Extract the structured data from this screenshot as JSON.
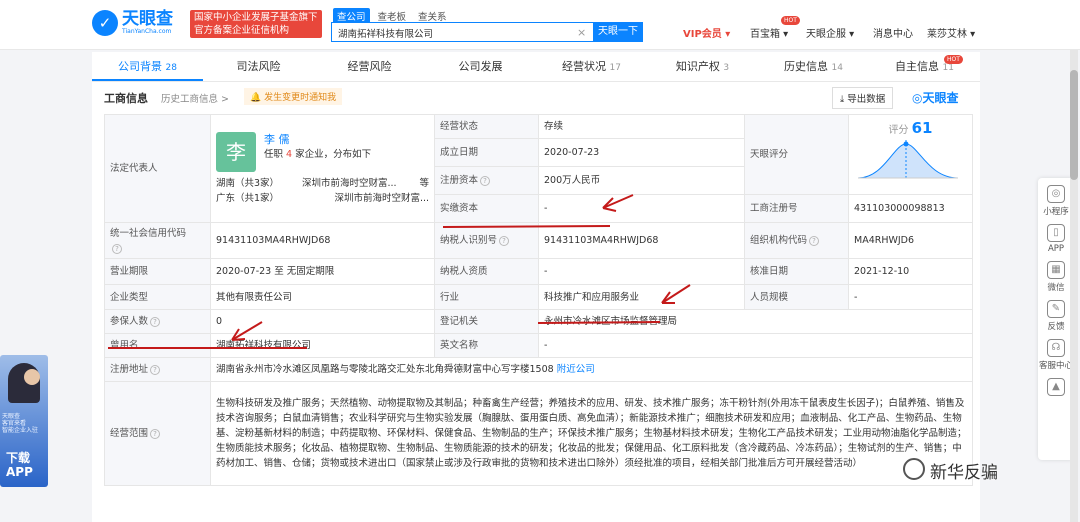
{
  "header": {
    "logo_cn": "天眼查",
    "logo_en": "TianYanCha.com",
    "slogan_1": "国家中小企业发展子基金旗下",
    "slogan_2": "官方备案企业征信机构",
    "search_tabs": [
      "查公司",
      "查老板",
      "查关系"
    ],
    "search_value": "湖南拓祥科技有限公司",
    "search_button": "天眼一下",
    "nav": {
      "vip": "VIP会员",
      "baobao": "百宝箱",
      "enterprise": "天眼企服",
      "messages": "消息中心",
      "user": "莱莎艾林"
    },
    "hot_badge": "HOT"
  },
  "tabs": [
    {
      "label": "公司背景",
      "count": "28"
    },
    {
      "label": "司法风险",
      "count": ""
    },
    {
      "label": "经营风险",
      "count": ""
    },
    {
      "label": "公司发展",
      "count": ""
    },
    {
      "label": "经营状况",
      "count": "17"
    },
    {
      "label": "知识产权",
      "count": "3"
    },
    {
      "label": "历史信息",
      "count": "14"
    },
    {
      "label": "自主信息",
      "count": "11"
    }
  ],
  "section": {
    "title": "工商信息",
    "history_link": "历史工商信息 >",
    "notice": "发生变更时通知我",
    "export": "导出数据",
    "watermark": "天眼查"
  },
  "info": {
    "legal_rep_label": "法定代表人",
    "legal_avatar": "李",
    "legal_name": "李 儒",
    "legal_post_pre": "任职",
    "legal_post_count": "4",
    "legal_post_post": "家企业，分布如下",
    "legal_dist_1": "湖南（共3家）",
    "legal_dist_1_company": "深圳市前海时空财富...",
    "legal_dist_1_more": "等",
    "legal_dist_2": "广东（共1家）",
    "legal_dist_2_company": "深圳市前海时空财富...",
    "status_label": "经营状态",
    "status_value": "存续",
    "founded_label": "成立日期",
    "founded_value": "2020-07-23",
    "reg_capital_label": "注册资本",
    "reg_capital_value": "200万人民币",
    "paid_capital_label": "实缴资本",
    "paid_capital_value": "-",
    "score_label": "天眼评分",
    "score_sub": "评分",
    "score_value": "61",
    "reg_no_label": "工商注册号",
    "reg_no_value": "431103000098813",
    "credit_code_label": "统一社会信用代码",
    "credit_code_value": "91431103MA4RHWJD68",
    "taxpayer_id_label": "纳税人识别号",
    "taxpayer_id_value": "91431103MA4RHWJD68",
    "org_code_label": "组织机构代码",
    "org_code_value": "MA4RHWJD6",
    "term_label": "营业期限",
    "term_value": "2020-07-23 至 无固定期限",
    "taxpayer_qual_label": "纳税人资质",
    "taxpayer_qual_value": "-",
    "approved_label": "核准日期",
    "approved_value": "2021-12-10",
    "type_label": "企业类型",
    "type_value": "其他有限责任公司",
    "industry_label": "行业",
    "industry_value": "科技推广和应用服务业",
    "staff_label": "人员规模",
    "staff_value": "-",
    "insured_label": "参保人数",
    "insured_value": "0",
    "authority_label": "登记机关",
    "authority_value": "永州市冷水滩区市场监督管理局",
    "former_name_label": "曾用名",
    "former_name_value": "湖南拓祥科技有限公司",
    "english_name_label": "英文名称",
    "english_name_value": "-",
    "address_label": "注册地址",
    "address_value": "湖南省永州市冷水滩区凤凰路与零陵北路交汇处东北角舜德财富中心写字楼1508",
    "address_link": "附近公司",
    "scope_label": "经营范围",
    "scope_value": "生物科技研发及推广服务；天然植物、动物提取物及其制品；种畜禽生产经营；养殖技术的应用、研发、技术推广服务；冻干粉针剂(外用冻干鼠表皮生长因子)；白鼠养殖、销售及技术咨询服务；白鼠血清销售；农业科学研究与生物实验发展（胸腺肽、蛋用蛋白质、高免血清）；新能源技术推广；细胞技术研发和应用；血液制品、化工产品、生物药品、生物基、淀粉基新材料的制造；中药提取物、环保材料、保健食品、生物制品的生产；环保技术推广服务；生物基材料技术研发；生物化工产品技术研发；工业用动物油脂化学品制造；生物质能技术服务；化妆品、植物提取物、生物制品、生物质能源的技术的研发；化妆品的批发；保健用品、化工原料批发（含冷藏药品、冷冻药品）；生物试剂的生产、销售；中药材加工、销售、仓储；货物或技术进出口（国家禁止或涉及行政审批的货物和技术进出口除外）须经批准的项目，经相关部门批准后方可开展经营活动）"
  },
  "sidebar": [
    "小程序",
    "APP",
    "微信",
    "反馈",
    "客服中心"
  ],
  "download": {
    "t1": "天眼查\n客官来看\n智能企业入驻",
    "t2": "下载\nAPP"
  },
  "overlay": {
    "xinhua": "新华反骗"
  },
  "colors": {
    "accent": "#0b84ff",
    "red": "#e8473b",
    "annotation": "#c41a1a"
  }
}
